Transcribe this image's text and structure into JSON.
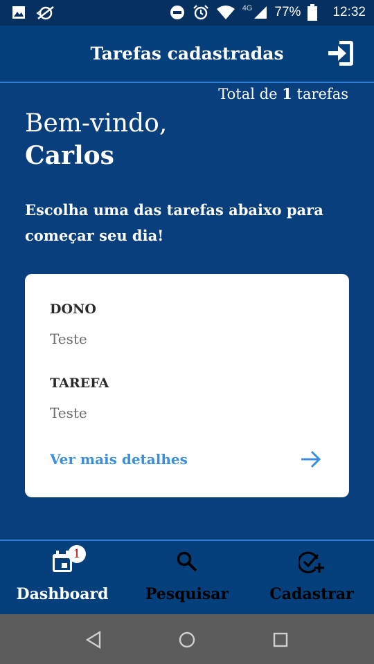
{
  "status_bar": {
    "network": "4G",
    "battery": "77%",
    "time": "12:32",
    "icons": [
      "image-icon",
      "no-sync-icon",
      "do-not-disturb-icon",
      "alarm-icon",
      "wifi-icon",
      "signal-icon",
      "battery-icon"
    ]
  },
  "app_bar": {
    "title": "Tarefas cadastradas",
    "action_icon": "logout-icon"
  },
  "summary": {
    "total_prefix": "Total de ",
    "total_count": "1",
    "total_suffix": " tarefas"
  },
  "welcome": {
    "greeting": "Bem-vindo,",
    "name": "Carlos",
    "subtitle": "Escolha uma das tarefas abaixo para começar seu dia!"
  },
  "task_card": {
    "owner_label": "DONO",
    "owner_value": "Teste",
    "task_label": "TAREFA",
    "task_value": "Teste",
    "details_link": "Ver mais detalhes",
    "details_icon": "arrow-right-icon"
  },
  "bottom_nav": {
    "items": [
      {
        "label": "Dashboard",
        "icon": "calendar-icon",
        "badge": "1",
        "color": "#ffffff"
      },
      {
        "label": "Pesquisar",
        "icon": "search-icon",
        "color": "#000000"
      },
      {
        "label": "Cadastrar",
        "icon": "check-add-icon",
        "color": "#000000"
      }
    ]
  },
  "colors": {
    "background": "#083f7c",
    "app_bar": "#05407d",
    "accent": "#3a8fdc",
    "card": "#ffffff",
    "badge_text": "#c40000"
  }
}
